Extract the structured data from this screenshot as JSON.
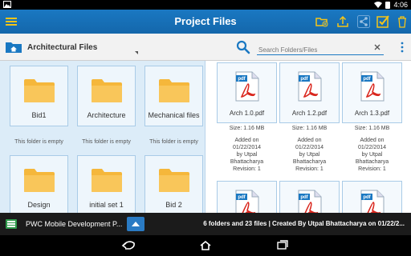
{
  "status_bar": {
    "time": "4:06"
  },
  "title_bar": {
    "title": "Project Files",
    "icons": [
      "menu-icon",
      "new-folder-icon",
      "upload-icon",
      "share-icon",
      "select-icon",
      "delete-icon"
    ]
  },
  "toolbar": {
    "current_folder": "Architectural Files",
    "search_placeholder": "Search Folders/Files"
  },
  "folders": [
    {
      "name": "Bid1",
      "status": "This folder is empty"
    },
    {
      "name": "Architecture",
      "status": "This folder is empty"
    },
    {
      "name": "Mechanical files",
      "status": "This folder is empty"
    },
    {
      "name": "Design"
    },
    {
      "name": "initial set 1"
    },
    {
      "name": "Bid 2"
    }
  ],
  "files": [
    {
      "name": "Arch 1.0.pdf",
      "size": "Size: 1.16 MB",
      "added_label": "Added on",
      "date": "01/22/2014",
      "by_label": "by Utpal",
      "author_last": "Bhattacharya",
      "revision": "Revision: 1"
    },
    {
      "name": "Arch 1.2.pdf",
      "size": "Size: 1.16 MB",
      "added_label": "Added on",
      "date": "01/22/2014",
      "by_label": "by Utpal",
      "author_last": "Bhattacharya",
      "revision": "Revision: 1"
    },
    {
      "name": "Arch 1.3.pdf",
      "size": "Size: 1.16 MB",
      "added_label": "Added on",
      "date": "01/22/2014",
      "by_label": "by Utpal",
      "author_last": "Bhattacharya",
      "revision": "Revision: 1"
    }
  ],
  "pdf_badge": "pdf",
  "footer": {
    "project_name": "PWC Mobile Development P...",
    "summary": "6 folders and 23 files | Created By Utpal Bhattacharya on 01/22/2..."
  },
  "colors": {
    "primary": "#1a78c2",
    "folder": "#f5b73b",
    "pdf_red": "#d9251c",
    "folder_panel": "#dcecf8"
  }
}
